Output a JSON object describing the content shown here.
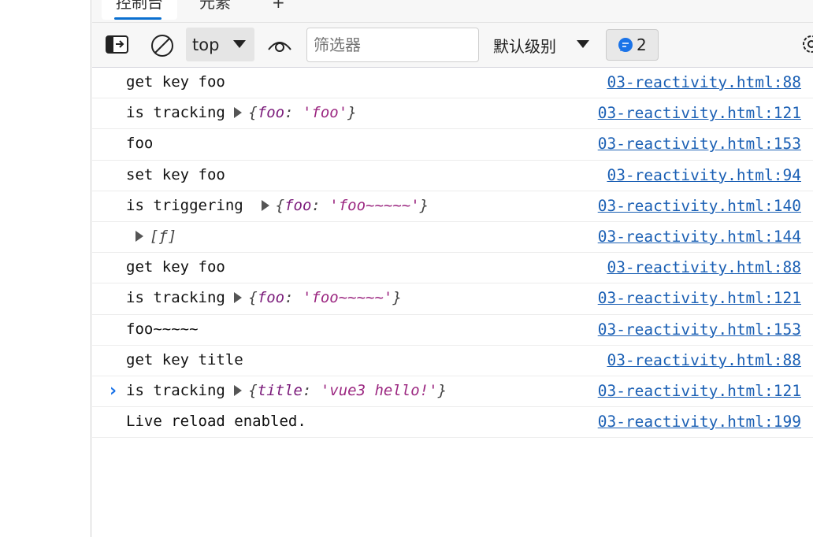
{
  "tabs": [
    "控制台",
    "元素",
    "+"
  ],
  "toolbar": {
    "context": "top",
    "filter_placeholder": "筛选器",
    "level": "默认级别",
    "message_count": "2"
  },
  "rows": [
    {
      "text": "get key foo",
      "link": "03-reactivity.html:88"
    },
    {
      "text": "is tracking",
      "obj": {
        "key": "foo",
        "value": "'foo'"
      },
      "link": "03-reactivity.html:121"
    },
    {
      "text": "foo",
      "link": "03-reactivity.html:153"
    },
    {
      "text": "set key foo",
      "link": "03-reactivity.html:94"
    },
    {
      "text": "is triggering ",
      "obj": {
        "key": "foo",
        "value": "'foo~~~~~'"
      },
      "link": "03-reactivity.html:140"
    },
    {
      "text": "",
      "arr": "[ƒ]",
      "link": "03-reactivity.html:144"
    },
    {
      "text": "get key foo",
      "link": "03-reactivity.html:88"
    },
    {
      "text": "is tracking",
      "obj": {
        "key": "foo",
        "value": "'foo~~~~~'"
      },
      "link": "03-reactivity.html:121"
    },
    {
      "text": "foo~~~~~",
      "link": "03-reactivity.html:153"
    },
    {
      "text": "get key title",
      "link": "03-reactivity.html:88"
    },
    {
      "text": "is tracking",
      "obj": {
        "key": "title",
        "value": "'vue3 hello!'"
      },
      "link": "03-reactivity.html:121"
    },
    {
      "text": "Live reload enabled.",
      "link": "03-reactivity.html:199"
    }
  ],
  "prompt": "›"
}
